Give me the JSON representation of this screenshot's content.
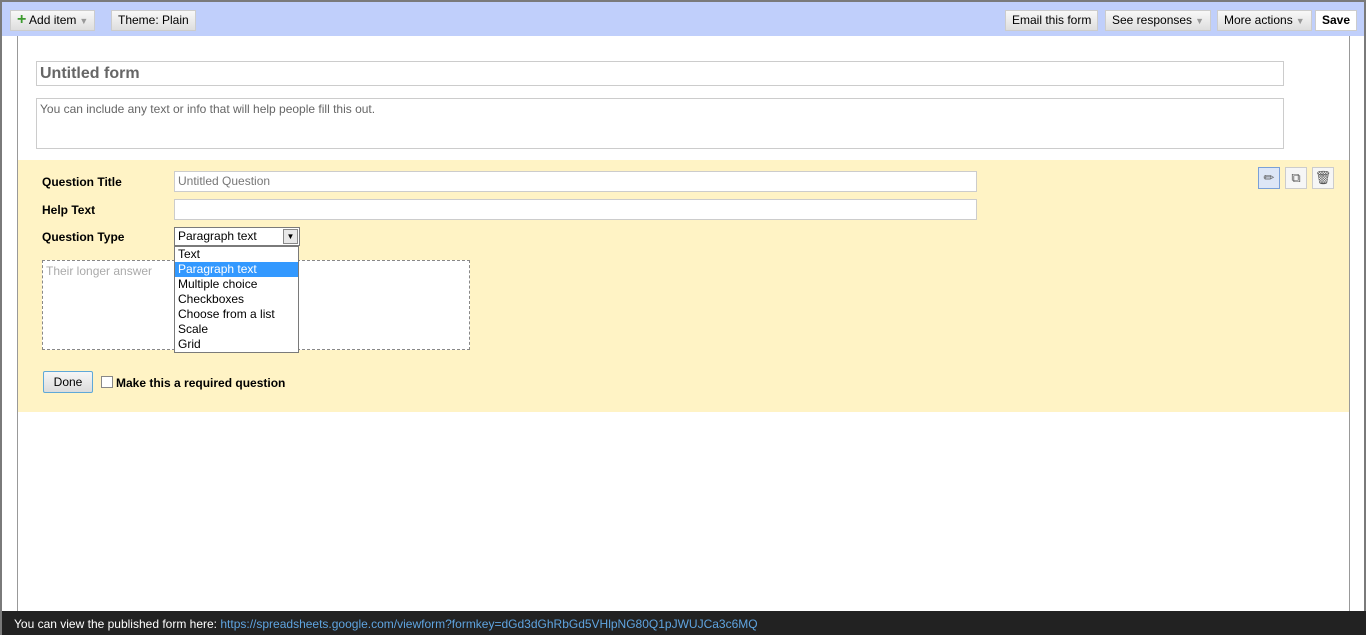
{
  "toolbar": {
    "add_item": "Add item",
    "theme": "Theme:  Plain",
    "email": "Email this form",
    "responses": "See responses",
    "more": "More actions",
    "save": "Save"
  },
  "form": {
    "title": "Untitled form",
    "description": "You can include any text or info that will help people fill this out."
  },
  "question": {
    "title_label": "Question Title",
    "title_value": "Untitled Question",
    "help_label": "Help Text",
    "help_value": "",
    "type_label": "Question Type",
    "type_selected": "Paragraph text",
    "type_options": [
      "Text",
      "Paragraph text",
      "Multiple choice",
      "Checkboxes",
      "Choose from a list",
      "Scale",
      "Grid"
    ],
    "answer_placeholder": "Their longer answer",
    "done": "Done",
    "required_label": "Make this a required question",
    "required_checked": false
  },
  "icons": {
    "edit": "pencil-icon",
    "duplicate": "duplicate-icon",
    "delete": "trash-icon"
  },
  "footer": {
    "text": "You can view the published form here:",
    "url": "https://spreadsheets.google.com/viewform?formkey=dGd3dGhRbGd5VHlpNG80Q1pJWUJCa3c6MQ"
  },
  "colors": {
    "toolbar": "#c0cffb",
    "question_bg": "#fff3c5",
    "highlight": "#3399ff",
    "footer": "#222222"
  }
}
